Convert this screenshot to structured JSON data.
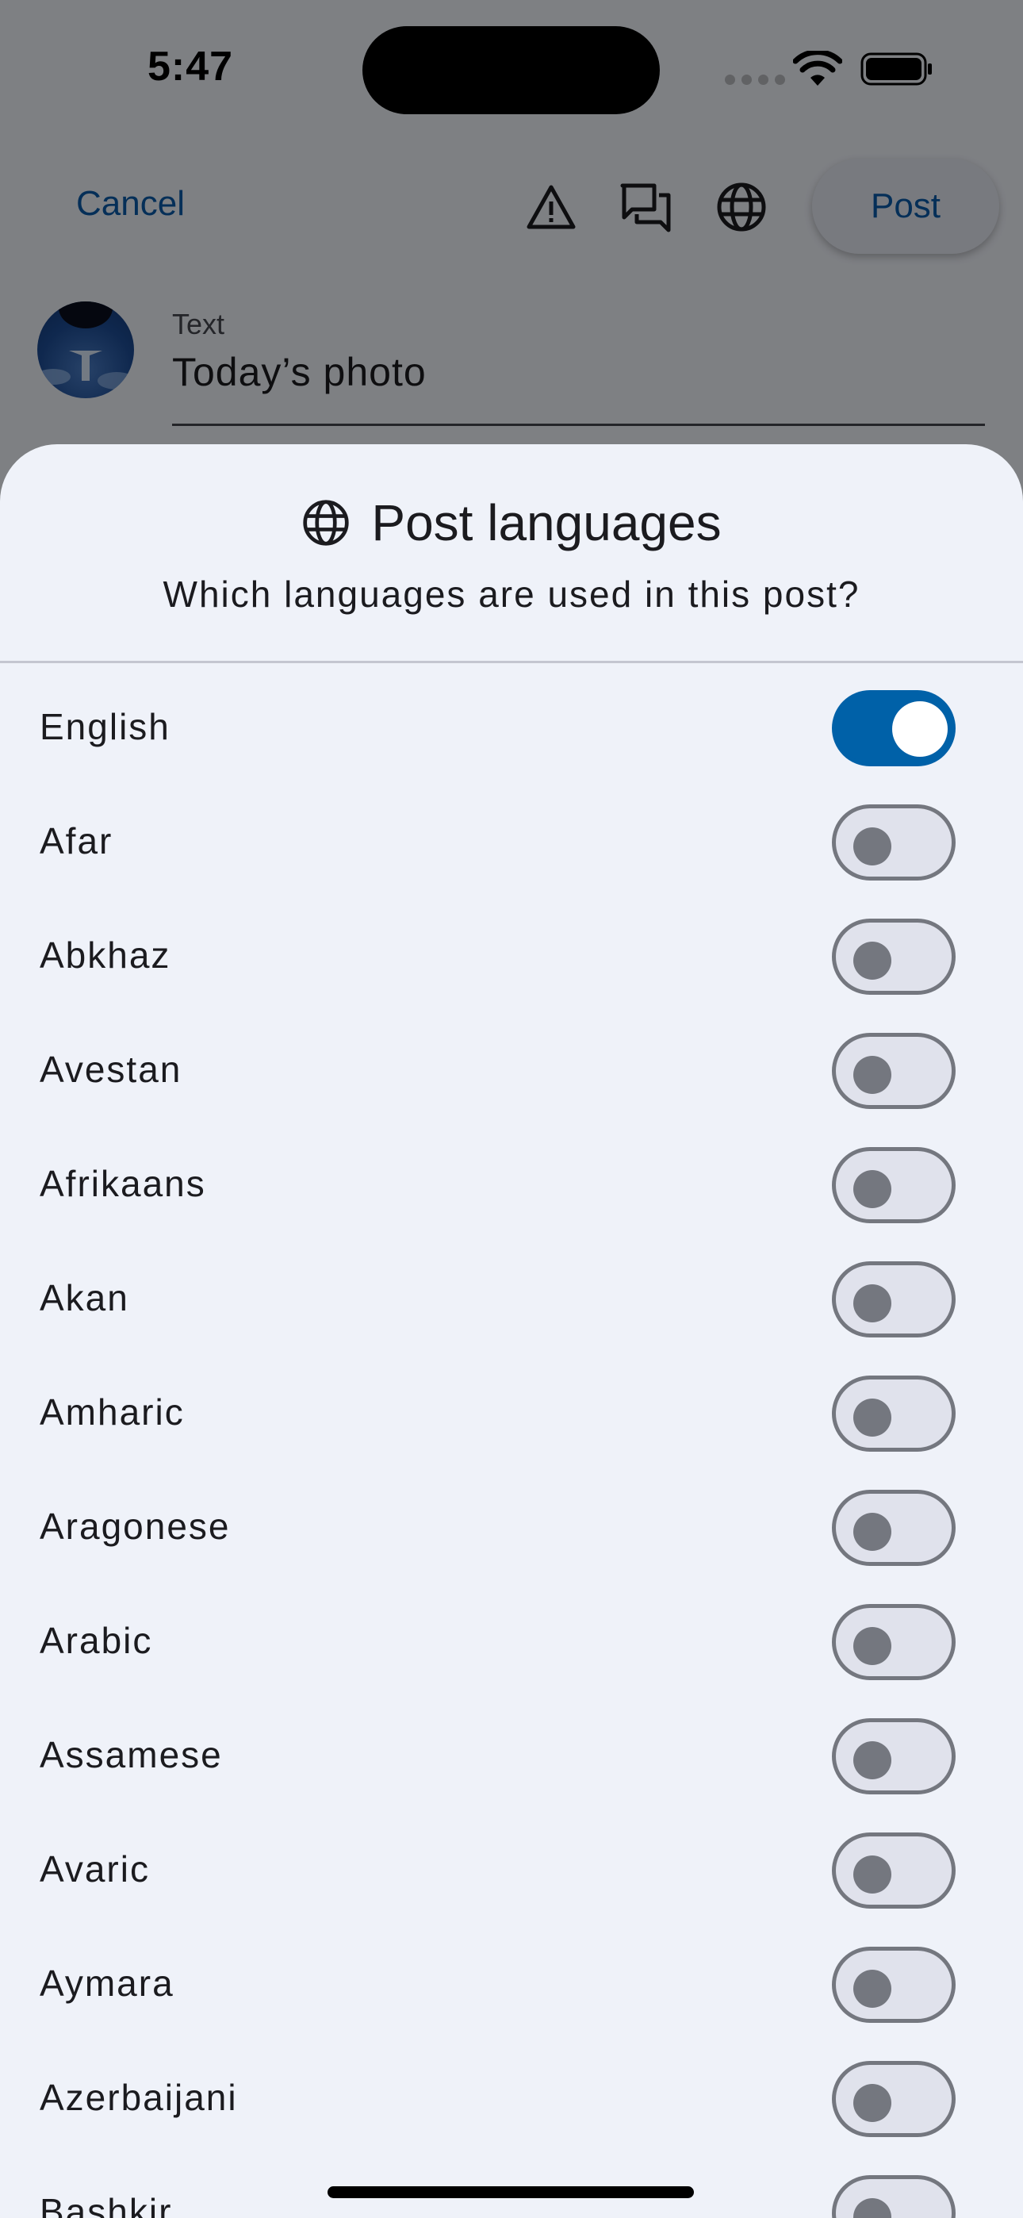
{
  "status_bar": {
    "time": "5:47"
  },
  "compose": {
    "cancel_label": "Cancel",
    "post_label": "Post",
    "text_field_label": "Text",
    "text_field_value": "Today’s photo",
    "icons": [
      "warning-icon",
      "chat-bubbles-icon",
      "globe-icon"
    ]
  },
  "sheet": {
    "title": "Post languages",
    "subtitle": "Which languages are used in this post?",
    "languages": [
      {
        "label": "English",
        "enabled": true
      },
      {
        "label": "Afar",
        "enabled": false
      },
      {
        "label": "Abkhaz",
        "enabled": false
      },
      {
        "label": "Avestan",
        "enabled": false
      },
      {
        "label": "Afrikaans",
        "enabled": false
      },
      {
        "label": "Akan",
        "enabled": false
      },
      {
        "label": "Amharic",
        "enabled": false
      },
      {
        "label": "Aragonese",
        "enabled": false
      },
      {
        "label": "Arabic",
        "enabled": false
      },
      {
        "label": "Assamese",
        "enabled": false
      },
      {
        "label": "Avaric",
        "enabled": false
      },
      {
        "label": "Aymara",
        "enabled": false
      },
      {
        "label": "Azerbaijani",
        "enabled": false
      },
      {
        "label": "Bashkir",
        "enabled": false
      }
    ]
  },
  "colors": {
    "accent": "#0061a8",
    "link": "#0b5aa7",
    "switch_off_track": "#e0e2ec",
    "switch_off_outline": "#74777f",
    "sheet_background": "#eff2f9"
  }
}
